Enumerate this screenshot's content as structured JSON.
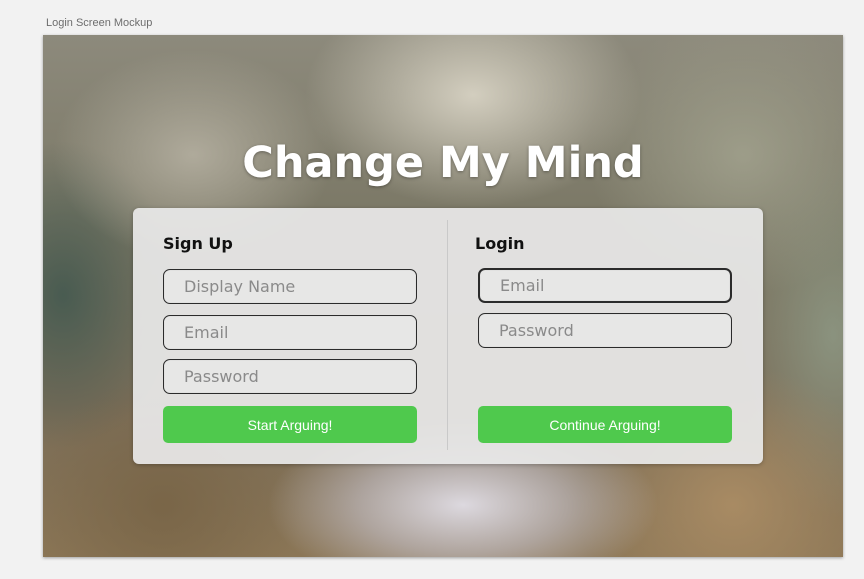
{
  "mockup_label": "Login Screen Mockup",
  "title": "Change My Mind",
  "signup": {
    "heading": "Sign Up",
    "display_name_placeholder": "Display Name",
    "email_placeholder": "Email",
    "password_placeholder": "Password",
    "button_label": "Start Arguing!"
  },
  "login": {
    "heading": "Login",
    "email_placeholder": "Email",
    "password_placeholder": "Password",
    "button_label": "Continue Arguing!"
  },
  "colors": {
    "button_green": "#4fc94d",
    "title_white": "#ffffff"
  }
}
